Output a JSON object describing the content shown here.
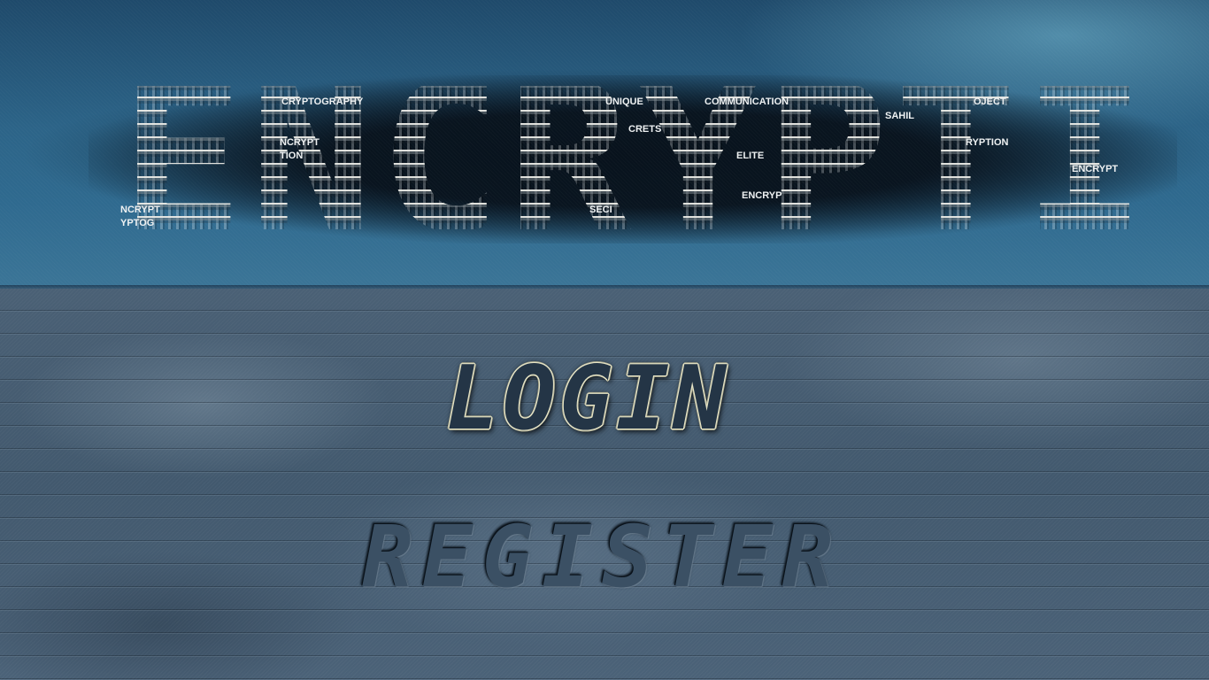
{
  "banner": {
    "title": "ENCRYPTION",
    "keywords": [
      "CRYPTOGRAPHY",
      "UNIQUE",
      "COMMUNICATION",
      "SAHIL",
      "OJECT",
      "NCRYPT",
      "CRETS",
      "RYPTION",
      "TION",
      "ELITE",
      "ENCRYPT",
      "ENCRYP",
      "NCRYPT",
      "SECI",
      "YPTOG"
    ]
  },
  "menu": {
    "login_label": "LOGIN",
    "register_label": "REGISTER"
  },
  "colors": {
    "banner_blue": "#2c6488",
    "panel_slate": "#4a6075",
    "login_outline": "#e6e4c6",
    "login_fill": "#243546"
  }
}
